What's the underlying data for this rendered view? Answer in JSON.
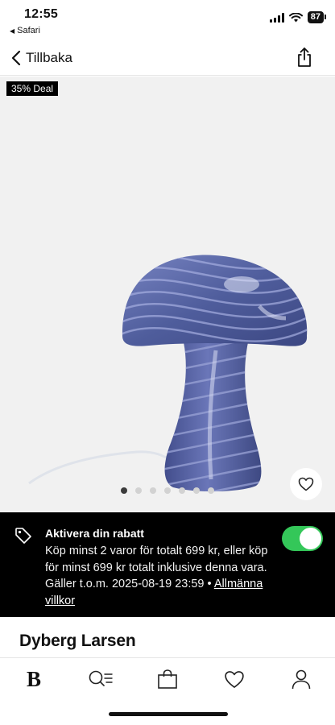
{
  "status_bar": {
    "time": "12:55",
    "back_app": "Safari",
    "battery": "87"
  },
  "nav": {
    "back_label": "Tillbaka",
    "share_icon": "share-icon"
  },
  "gallery": {
    "deal_badge": "35% Deal",
    "image_count": 7,
    "active_index": 0
  },
  "discount": {
    "title": "Aktivera din rabatt",
    "text": "Köp minst 2 varor för totalt 699 kr, eller köp för minst 699 kr totalt inklusive denna vara. Gäller t.o.m. 2025-08-19 23:59 •",
    "link": "Allmänna villkor",
    "toggle_on": true,
    "toggle_color": "#34c759"
  },
  "product": {
    "brand": "Dyberg Larsen"
  },
  "tabbar": {
    "logo": "B",
    "items": [
      "home-logo",
      "search-icon",
      "bag-icon",
      "heart-icon",
      "profile-icon"
    ]
  },
  "colors": {
    "lamp": "#4f5d9c",
    "accent": "#34c759",
    "banner": "#000000"
  }
}
